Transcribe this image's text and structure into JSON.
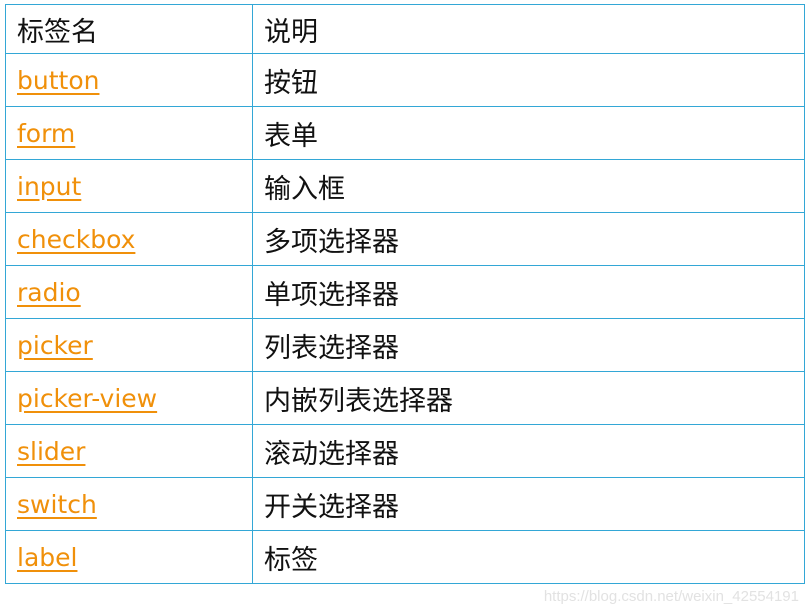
{
  "table": {
    "headers": [
      "标签名",
      "说明"
    ],
    "rows": [
      {
        "tag": "button",
        "desc": "按钮"
      },
      {
        "tag": "form",
        "desc": "表单"
      },
      {
        "tag": "input",
        "desc": "输入框"
      },
      {
        "tag": "checkbox",
        "desc": "多项选择器"
      },
      {
        "tag": "radio",
        "desc": "单项选择器"
      },
      {
        "tag": "picker",
        "desc": "列表选择器"
      },
      {
        "tag": "picker-view",
        "desc": "内嵌列表选择器"
      },
      {
        "tag": "slider",
        "desc": "滚动选择器"
      },
      {
        "tag": "switch",
        "desc": "开关选择器"
      },
      {
        "tag": "label",
        "desc": "标签"
      }
    ]
  },
  "colors": {
    "border": "#33a7d6",
    "link": "#f0900a",
    "text": "#111111"
  },
  "watermark": "https://blog.csdn.net/weixin_42554191"
}
